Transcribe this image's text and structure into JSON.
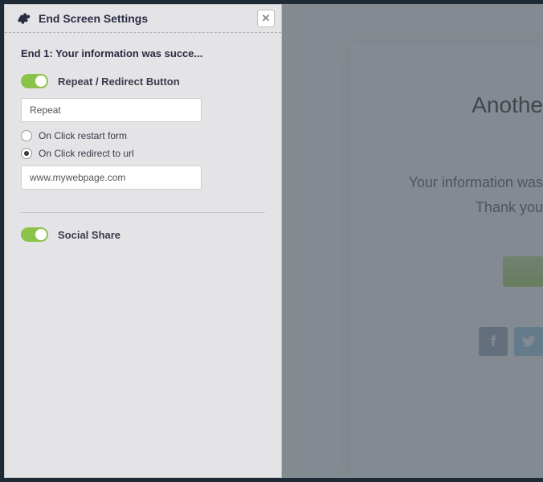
{
  "sidebar": {
    "title": "End Screen Settings",
    "section_title": "End 1: Your information was succe...",
    "toggle1_label": "Repeat / Redirect Button",
    "button_text_value": "Repeat",
    "radio1_label": "On Click restart form",
    "radio2_label": "On Click redirect to url",
    "url_value": "www.mywebpage.com",
    "toggle2_label": "Social Share"
  },
  "preview": {
    "heading": "Anothe",
    "line1": "Your information was",
    "line2": "Thank you"
  }
}
